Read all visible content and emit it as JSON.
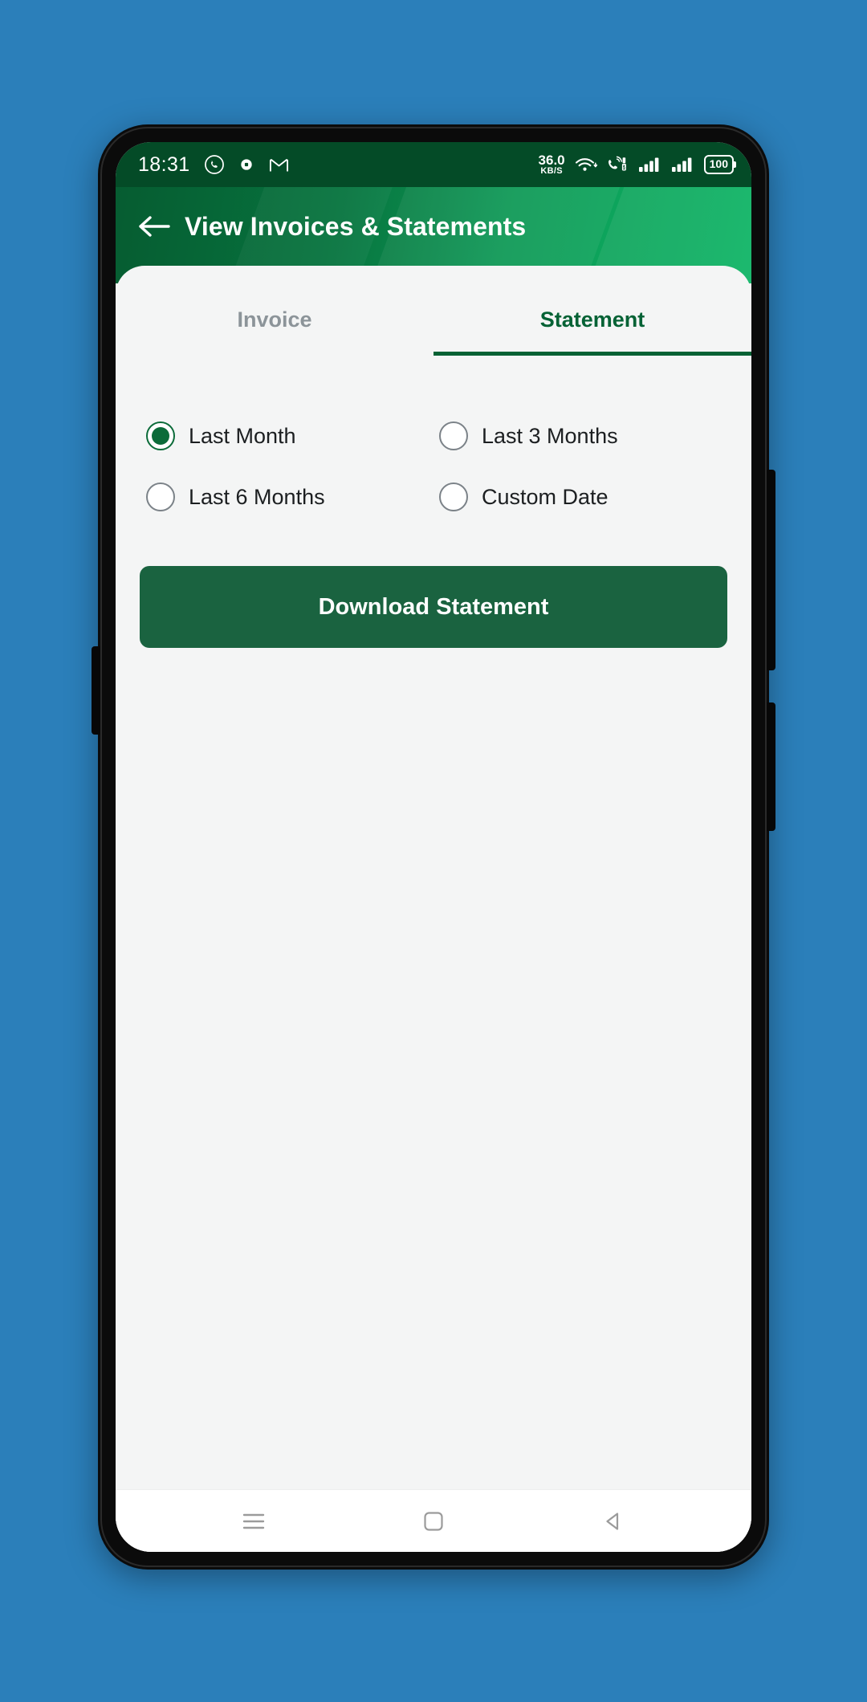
{
  "theme": {
    "background": "#2b7fba",
    "status_bar_bg": "#044b27",
    "header_gradient_start": "#065c31",
    "header_gradient_end": "#0bb463",
    "accent_green": "#056235",
    "button_green": "#1a6340",
    "sheet_bg": "#f4f5f5",
    "inactive_tab": "#8c9499"
  },
  "status_bar": {
    "time": "18:31",
    "left_icons": [
      "whatsapp-icon",
      "dot-notification-icon",
      "gmail-icon"
    ],
    "net_speed_value": "36.0",
    "net_speed_unit": "KB/S",
    "right_icons": [
      "wifi-icon",
      "volte-call-icon",
      "signal-bars-sim1-icon",
      "signal-bars-sim2-icon"
    ],
    "battery_level": "100"
  },
  "app_bar": {
    "back_icon": "arrow-left-icon",
    "title": "View Invoices & Statements"
  },
  "tabs": [
    {
      "id": "invoice",
      "label": "Invoice",
      "active": false
    },
    {
      "id": "statement",
      "label": "Statement",
      "active": true
    }
  ],
  "options": {
    "selected_id": "last_month",
    "items": [
      {
        "id": "last_month",
        "label": "Last Month",
        "selected": true
      },
      {
        "id": "last_3_months",
        "label": "Last 3 Months",
        "selected": false
      },
      {
        "id": "last_6_months",
        "label": "Last 6 Months",
        "selected": false
      },
      {
        "id": "custom_date",
        "label": "Custom Date",
        "selected": false
      }
    ]
  },
  "primary_action": {
    "label": "Download Statement"
  },
  "nav_bar": {
    "recents_icon": "menu-lines-icon",
    "home_icon": "home-square-icon",
    "back_icon": "back-triangle-icon"
  }
}
